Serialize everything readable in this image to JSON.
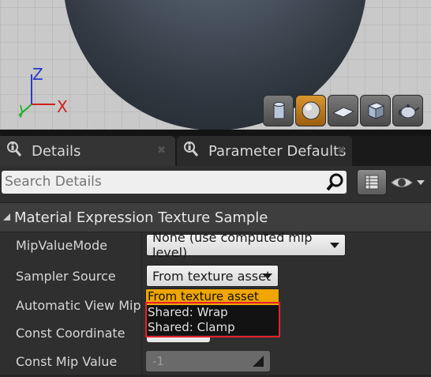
{
  "viewport": {
    "axes": {
      "z": "Z",
      "y": "Y",
      "x": "X"
    },
    "shapes": [
      {
        "icon": "cylinder-icon",
        "active": false
      },
      {
        "icon": "sphere-icon",
        "active": true
      },
      {
        "icon": "plane-icon",
        "active": false
      },
      {
        "icon": "cube-icon",
        "active": false
      },
      {
        "icon": "teapot-icon",
        "active": false
      }
    ]
  },
  "tabs": [
    {
      "label": "Details",
      "icon": "details-search-icon"
    },
    {
      "label": "Parameter Defaults",
      "icon": "details-search-icon"
    }
  ],
  "search": {
    "placeholder": "Search Details"
  },
  "category": {
    "title": "Material Expression Texture Sample"
  },
  "properties": {
    "mip_value_mode": {
      "label": "MipValueMode",
      "value": "None (use computed mip level)"
    },
    "sampler_source": {
      "label": "Sampler Source",
      "value": "From texture asset"
    },
    "auto_view_mip": {
      "label": "Automatic View Mip Bias"
    },
    "const_coordinate": {
      "label": "Const Coordinate"
    },
    "const_mip_value": {
      "label": "Const Mip Value",
      "value": "-1"
    }
  },
  "dropdown": {
    "options": [
      "From texture asset",
      "Shared: Wrap",
      "Shared: Clamp"
    ],
    "selected": "From texture asset"
  },
  "colors": {
    "accent": "#f0a500",
    "highlight": "#e5212a"
  }
}
